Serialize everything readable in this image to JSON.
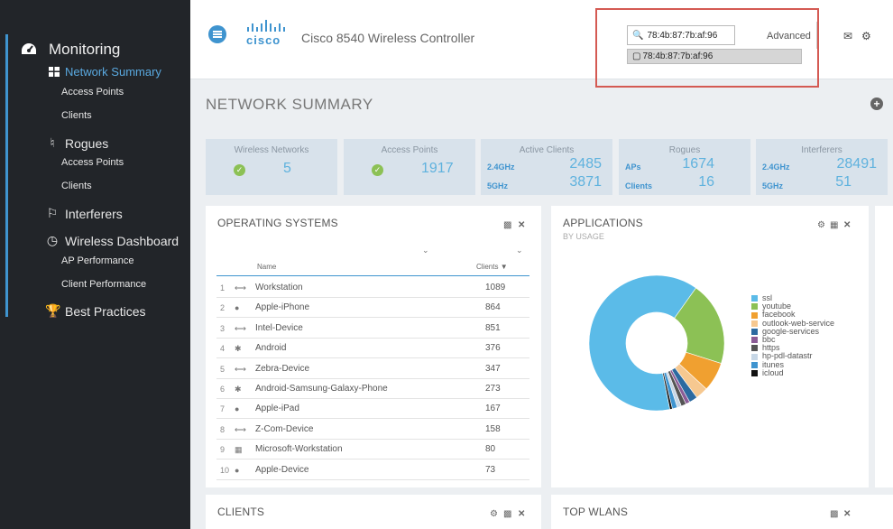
{
  "sidebar": {
    "monitoring": "Monitoring",
    "network_summary": "Network Summary",
    "access_points": "Access Points",
    "clients": "Clients",
    "rogues": "Rogues",
    "rogue_access_points": "Access Points",
    "rogue_clients": "Clients",
    "interferers": "Interferers",
    "wireless_dashboard": "Wireless Dashboard",
    "ap_performance": "AP Performance",
    "client_performance": "Client Performance",
    "best_practices": "Best Practices"
  },
  "header": {
    "logo_text": "cisco",
    "title": "Cisco 8540 Wireless Controller",
    "search_value": "78:4b:87:7b:af:96",
    "suggestion": "78:4b:87:7b:af:96",
    "advanced": "Advanced"
  },
  "page_title": "NETWORK SUMMARY",
  "stats": {
    "wireless_networks": {
      "label": "Wireless Networks",
      "value": "5"
    },
    "access_points": {
      "label": "Access Points",
      "value": "1917"
    },
    "active_clients": {
      "label": "Active Clients",
      "row1_label": "2.4GHz",
      "row1_value": "2485",
      "row2_label": "5GHz",
      "row2_value": "3871"
    },
    "rogues": {
      "label": "Rogues",
      "row1_label": "APs",
      "row1_value": "1674",
      "row2_label": "Clients",
      "row2_value": "16"
    },
    "interferers": {
      "label": "Interferers",
      "row1_label": "2.4GHz",
      "row1_value": "28491",
      "row2_label": "5GHz",
      "row2_value": "51"
    }
  },
  "os_panel": {
    "title": "OPERATING SYSTEMS",
    "col_name": "Name",
    "col_clients": "Clients",
    "rows": [
      {
        "num": "1",
        "icon": "link-icon",
        "name": "Workstation",
        "count": "1089"
      },
      {
        "num": "2",
        "icon": "apple-icon",
        "name": "Apple-iPhone",
        "count": "864"
      },
      {
        "num": "3",
        "icon": "link-icon",
        "name": "Intel-Device",
        "count": "851"
      },
      {
        "num": "4",
        "icon": "android-icon",
        "name": "Android",
        "count": "376"
      },
      {
        "num": "5",
        "icon": "link-icon",
        "name": "Zebra-Device",
        "count": "347"
      },
      {
        "num": "6",
        "icon": "android-icon",
        "name": "Android-Samsung-Galaxy-Phone",
        "count": "273"
      },
      {
        "num": "7",
        "icon": "apple-icon",
        "name": "Apple-iPad",
        "count": "167"
      },
      {
        "num": "8",
        "icon": "link-icon",
        "name": "Z-Com-Device",
        "count": "158"
      },
      {
        "num": "9",
        "icon": "windows-icon",
        "name": "Microsoft-Workstation",
        "count": "80"
      },
      {
        "num": "10",
        "icon": "apple-icon",
        "name": "Apple-Device",
        "count": "73"
      }
    ]
  },
  "applications": {
    "title": "APPLICATIONS",
    "subtitle": "BY USAGE"
  },
  "clients_panel": {
    "title": "CLIENTS"
  },
  "top_wlans_panel": {
    "title": "TOP WLANS"
  },
  "chart_data": {
    "type": "pie",
    "title": "APPLICATIONS",
    "subtitle": "BY USAGE",
    "categories": [
      "ssl",
      "youtube",
      "facebook",
      "outlook-web-service",
      "google-services",
      "bbc",
      "https",
      "hp-pdl-datastr",
      "itunes",
      "icloud"
    ],
    "values": [
      63,
      20,
      7,
      3,
      2,
      1,
      1.2,
      1,
      1.2,
      0.6
    ],
    "colors": [
      "#5bbbe8",
      "#8cc155",
      "#f0a030",
      "#f6c890",
      "#2c6aa0",
      "#8b5c96",
      "#555555",
      "#c7d7e6",
      "#3f94cf",
      "#111111"
    ],
    "legend_position": "right"
  }
}
